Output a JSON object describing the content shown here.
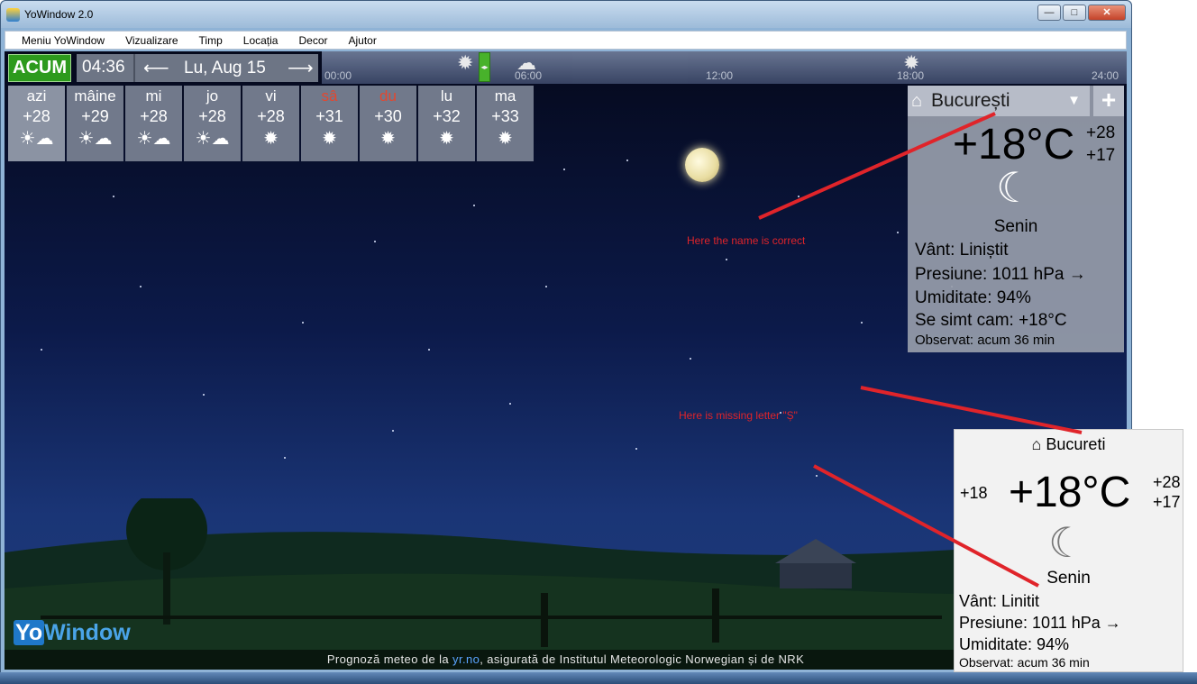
{
  "window": {
    "title": "YoWindow 2.0"
  },
  "menu": [
    "Meniu YoWindow",
    "Vizualizare",
    "Timp",
    "Locația",
    "Decor",
    "Ajutor"
  ],
  "topbar": {
    "now_label": "ACUM",
    "time": "04:36",
    "date": "Lu, Aug 15",
    "timeline_ticks": [
      "00:00",
      "06:00",
      "12:00",
      "18:00",
      "24:00"
    ]
  },
  "forecast": [
    {
      "day": "azi",
      "temp": "+28",
      "icon": "sun-cloud-icon",
      "weekend": false
    },
    {
      "day": "mâine",
      "temp": "+29",
      "icon": "sun-cloud-icon",
      "weekend": false
    },
    {
      "day": "mi",
      "temp": "+28",
      "icon": "sun-cloud-icon",
      "weekend": false
    },
    {
      "day": "jo",
      "temp": "+28",
      "icon": "sun-cloud-icon",
      "weekend": false
    },
    {
      "day": "vi",
      "temp": "+28",
      "icon": "sun-icon",
      "weekend": false
    },
    {
      "day": "sâ",
      "temp": "+31",
      "icon": "sun-icon",
      "weekend": true
    },
    {
      "day": "du",
      "temp": "+30",
      "icon": "sun-icon",
      "weekend": true
    },
    {
      "day": "lu",
      "temp": "+32",
      "icon": "sun-icon",
      "weekend": false
    },
    {
      "day": "ma",
      "temp": "+33",
      "icon": "sun-icon",
      "weekend": false
    }
  ],
  "panel": {
    "location": "București",
    "temp": "+18°C",
    "high": "+28",
    "low": "+17",
    "condition": "Senin",
    "wind": "Vânt:  Liniștit",
    "pressure": "Presiune:  1011 hPa  →",
    "humidity": "Umiditate:  94%",
    "feels_like": "Se simt cam:  +18°C",
    "observed": "Observat:  acum 36 min"
  },
  "annotations": {
    "correct": "Here the name is correct",
    "missing": "Here is missing  letter  \"Ș\""
  },
  "logo": {
    "part1": "Yo",
    "part2": "Window"
  },
  "footer": {
    "before": "Prognoză meteo de la  ",
    "link": "yr.no",
    "after": ", asigurată de Institutul Meteorologic Norwegian și de NRK"
  },
  "widget": {
    "location": "Bucureti",
    "small_temp": "+18",
    "temp": "+18°C",
    "high": "+28",
    "low": "+17",
    "condition": "Senin",
    "wind": "Vânt:  Linitit",
    "pressure": "Presiune:  1011 hPa →",
    "humidity": "Umiditate:  94%",
    "observed": "Observat:  acum 36 min"
  },
  "colors": {
    "accent_green": "#2d9a1d",
    "annotation_red": "#e0242a",
    "weekend_red": "#e3472f"
  }
}
